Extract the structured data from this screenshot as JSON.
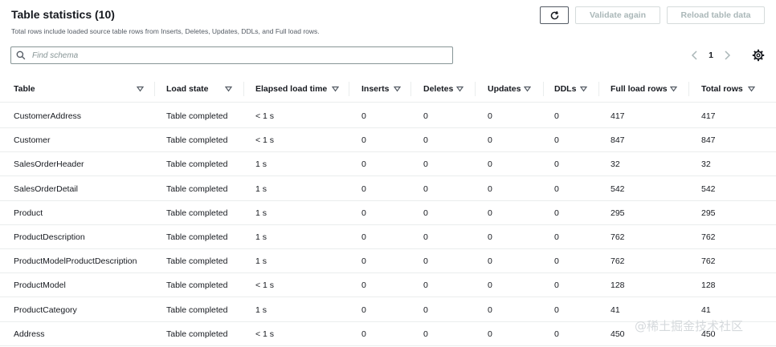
{
  "header": {
    "title": "Table statistics (10)",
    "subtitle": "Total rows include loaded source table rows from Inserts, Deletes, Updates, DDLs, and Full load rows."
  },
  "actions": {
    "refresh_icon": "refresh-icon",
    "validate_label": "Validate again",
    "reload_label": "Reload table data"
  },
  "search": {
    "placeholder": "Find schema",
    "value": ""
  },
  "pagination": {
    "current_page": "1"
  },
  "table": {
    "columns": [
      "Table",
      "Load state",
      "Elapsed load time",
      "Inserts",
      "Deletes",
      "Updates",
      "DDLs",
      "Full load rows",
      "Total rows"
    ],
    "rows": [
      [
        "CustomerAddress",
        "Table completed",
        "< 1 s",
        "0",
        "0",
        "0",
        "0",
        "417",
        "417"
      ],
      [
        "Customer",
        "Table completed",
        "< 1 s",
        "0",
        "0",
        "0",
        "0",
        "847",
        "847"
      ],
      [
        "SalesOrderHeader",
        "Table completed",
        "1 s",
        "0",
        "0",
        "0",
        "0",
        "32",
        "32"
      ],
      [
        "SalesOrderDetail",
        "Table completed",
        "1 s",
        "0",
        "0",
        "0",
        "0",
        "542",
        "542"
      ],
      [
        "Product",
        "Table completed",
        "1 s",
        "0",
        "0",
        "0",
        "0",
        "295",
        "295"
      ],
      [
        "ProductDescription",
        "Table completed",
        "1 s",
        "0",
        "0",
        "0",
        "0",
        "762",
        "762"
      ],
      [
        "ProductModelProductDescription",
        "Table completed",
        "1 s",
        "0",
        "0",
        "0",
        "0",
        "762",
        "762"
      ],
      [
        "ProductModel",
        "Table completed",
        "< 1 s",
        "0",
        "0",
        "0",
        "0",
        "128",
        "128"
      ],
      [
        "ProductCategory",
        "Table completed",
        "1 s",
        "0",
        "0",
        "0",
        "0",
        "41",
        "41"
      ],
      [
        "Address",
        "Table completed",
        "< 1 s",
        "0",
        "0",
        "0",
        "0",
        "450",
        "450"
      ]
    ]
  },
  "watermark": "@稀土掘金技术社区"
}
